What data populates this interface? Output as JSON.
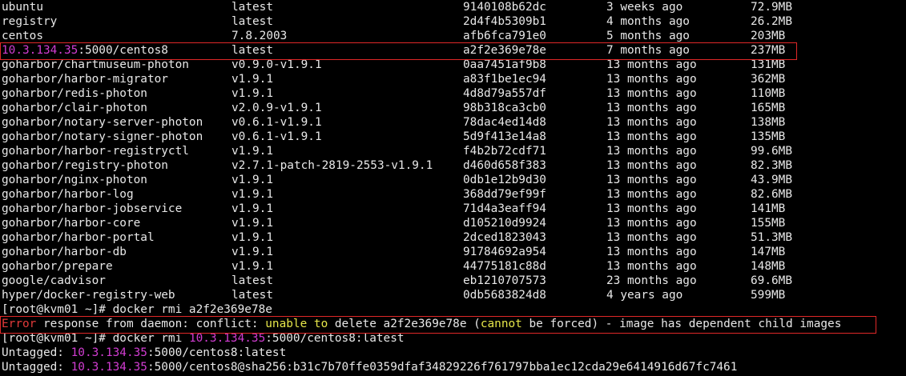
{
  "images": [
    {
      "repo": "ubuntu",
      "tag": "latest",
      "id": "9140108b62dc",
      "created": "3 weeks ago",
      "size": "72.9MB"
    },
    {
      "repo": "registry",
      "tag": "latest",
      "id": "2d4f4b5309b1",
      "created": "4 months ago",
      "size": "26.2MB"
    },
    {
      "repo": "centos",
      "tag": "7.8.2003",
      "id": "afb6fca791e0",
      "created": "5 months ago",
      "size": "203MB"
    },
    {
      "repo_host": "10.3.134.35",
      "repo_rest": ":5000/centos8",
      "tag": "latest",
      "id": "a2f2e369e78e",
      "created": "7 months ago",
      "size": "237MB"
    },
    {
      "repo": "goharbor/chartmuseum-photon",
      "tag": "v0.9.0-v1.9.1",
      "id": "0aa7451af9b8",
      "created": "13 months ago",
      "size": "131MB"
    },
    {
      "repo": "goharbor/harbor-migrator",
      "tag": "v1.9.1",
      "id": "a83f1be1ec94",
      "created": "13 months ago",
      "size": "362MB"
    },
    {
      "repo": "goharbor/redis-photon",
      "tag": "v1.9.1",
      "id": "4d8d79a557df",
      "created": "13 months ago",
      "size": "110MB"
    },
    {
      "repo": "goharbor/clair-photon",
      "tag": "v2.0.9-v1.9.1",
      "id": "98b318ca3cb0",
      "created": "13 months ago",
      "size": "165MB"
    },
    {
      "repo": "goharbor/notary-server-photon",
      "tag": "v0.6.1-v1.9.1",
      "id": "78dac4ed14d8",
      "created": "13 months ago",
      "size": "138MB"
    },
    {
      "repo": "goharbor/notary-signer-photon",
      "tag": "v0.6.1-v1.9.1",
      "id": "5d9f413e14a8",
      "created": "13 months ago",
      "size": "135MB"
    },
    {
      "repo": "goharbor/harbor-registryctl",
      "tag": "v1.9.1",
      "id": "f4b2b72cdf71",
      "created": "13 months ago",
      "size": "99.6MB"
    },
    {
      "repo": "goharbor/registry-photon",
      "tag": "v2.7.1-patch-2819-2553-v1.9.1",
      "id": "d460d658f383",
      "created": "13 months ago",
      "size": "82.3MB"
    },
    {
      "repo": "goharbor/nginx-photon",
      "tag": "v1.9.1",
      "id": "0db1e12b9d30",
      "created": "13 months ago",
      "size": "43.9MB"
    },
    {
      "repo": "goharbor/harbor-log",
      "tag": "v1.9.1",
      "id": "368dd79ef99f",
      "created": "13 months ago",
      "size": "82.6MB"
    },
    {
      "repo": "goharbor/harbor-jobservice",
      "tag": "v1.9.1",
      "id": "71d4a3eaff94",
      "created": "13 months ago",
      "size": "141MB"
    },
    {
      "repo": "goharbor/harbor-core",
      "tag": "v1.9.1",
      "id": "d105210d9924",
      "created": "13 months ago",
      "size": "155MB"
    },
    {
      "repo": "goharbor/harbor-portal",
      "tag": "v1.9.1",
      "id": "2dced1823043",
      "created": "13 months ago",
      "size": "51.3MB"
    },
    {
      "repo": "goharbor/harbor-db",
      "tag": "v1.9.1",
      "id": "91784692a954",
      "created": "13 months ago",
      "size": "147MB"
    },
    {
      "repo": "goharbor/prepare",
      "tag": "v1.9.1",
      "id": "44775181c88d",
      "created": "13 months ago",
      "size": "148MB"
    },
    {
      "repo": "google/cadvisor",
      "tag": "latest",
      "id": "eb1210707573",
      "created": "23 months ago",
      "size": "69.6MB"
    },
    {
      "repo": "hyper/docker-registry-web",
      "tag": "latest",
      "id": "0db5683824d8",
      "created": "4 years ago",
      "size": "599MB"
    }
  ],
  "cmd1": {
    "prompt": "[root@kvm01 ~]# ",
    "command": "docker rmi a2f2e369e78e"
  },
  "error": {
    "prefix": "Error",
    "seg1": " response from daemon: conflict: ",
    "seg2": "unable",
    "seg3": " ",
    "seg4": "to",
    "seg5": " delete a2f2e369e78e (",
    "seg6": "cannot",
    "seg7": " be forced) - image has dependent child images"
  },
  "cmd2": {
    "prompt": "[root@kvm01 ~]# ",
    "command_pre": "docker rmi ",
    "host": "10.3.134.35",
    "command_rest": ":5000/centos8:latest"
  },
  "untag1": {
    "label": "Untagged: ",
    "host": "10.3.134.35",
    "rest": ":5000/centos8:latest"
  },
  "untag2": {
    "label": "Untagged: ",
    "host": "10.3.134.35",
    "rest": ":5000/centos8@sha256:b31c7b70ffe0359dfaf34829226f761797bba1ec12cda29e6414916d67fc7461"
  },
  "colors": {
    "background": "#000000",
    "text": "#e8e8e8",
    "highlight_host": "#d23dd2",
    "keyword": "#e6e64a",
    "error": "#e23a3a",
    "annotation_box": "#e02828"
  }
}
